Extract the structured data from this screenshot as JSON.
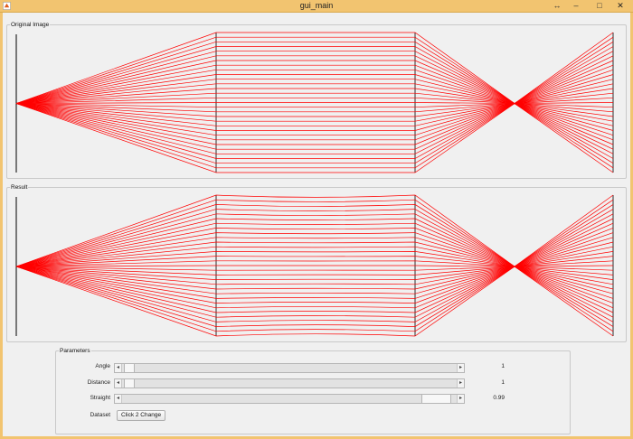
{
  "window": {
    "title": "gui_main",
    "controls": {
      "resize_icon": "arrows-horizontal",
      "minimize_icon": "minimize",
      "maximize_icon": "maximize",
      "close_icon": "close"
    },
    "titlebar_color": "#f2c470"
  },
  "panels": {
    "original": {
      "title": "Original Image"
    },
    "result": {
      "title": "Result"
    }
  },
  "line_color": "#ff0000",
  "parameters": {
    "title": "Parameters",
    "rows": [
      {
        "label": "Angle",
        "value": "1",
        "slider_fraction": 0.0
      },
      {
        "label": "Distance",
        "value": "1",
        "slider_fraction": 0.0
      },
      {
        "label": "Straight",
        "value": "0.99",
        "slider_fraction": 0.99
      }
    ],
    "dataset": {
      "label": "Dataset",
      "button_label": "Click 2 Change"
    }
  }
}
